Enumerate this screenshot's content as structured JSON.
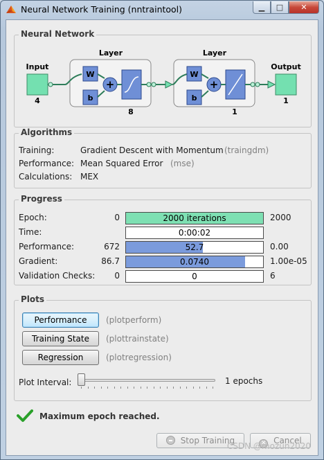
{
  "window": {
    "title": "Neural Network Training (nntraintool)"
  },
  "network": {
    "section_title": "Neural Network",
    "input_label": "Input",
    "input_size": "4",
    "hidden_layer_label": "Layer",
    "hidden_size": "8",
    "output_layer_label": "Layer",
    "output_layer_size": "1",
    "output_label": "Output",
    "output_size": "1",
    "weight_label": "W",
    "bias_label": "b",
    "sum_symbol": "+"
  },
  "algorithms": {
    "section_title": "Algorithms",
    "rows": [
      {
        "label": "Training:",
        "value": "Gradient Descent with Momentum",
        "func": "(traingdm)"
      },
      {
        "label": "Performance:",
        "value": "Mean Squared Error",
        "func": "(mse)"
      },
      {
        "label": "Calculations:",
        "value": "MEX",
        "func": ""
      }
    ]
  },
  "progress": {
    "section_title": "Progress",
    "rows": [
      {
        "label": "Epoch:",
        "start": "0",
        "bar_text": "2000 iterations",
        "end": "2000",
        "fill": 1.0,
        "fill_color": "#7ee0b3"
      },
      {
        "label": "Time:",
        "start": "",
        "bar_text": "0:00:02",
        "end": "",
        "fill": 0,
        "fill_color": "#ffffff"
      },
      {
        "label": "Performance:",
        "start": "672",
        "bar_text": "52.7",
        "end": "0.00",
        "fill": 0.56,
        "fill_color": "#7b9bdc"
      },
      {
        "label": "Gradient:",
        "start": "86.7",
        "bar_text": "0.0740",
        "end": "1.00e-05",
        "fill": 0.87,
        "fill_color": "#7b9bdc"
      },
      {
        "label": "Validation Checks:",
        "start": "0",
        "bar_text": "0",
        "end": "6",
        "fill": 0,
        "fill_color": "#ffffff"
      }
    ]
  },
  "plots": {
    "section_title": "Plots",
    "buttons": [
      {
        "label": "Performance",
        "func": "(plotperform)"
      },
      {
        "label": "Training State",
        "func": "(plottrainstate)"
      },
      {
        "label": "Regression",
        "func": "(plotregression)"
      }
    ],
    "interval_label": "Plot Interval:",
    "interval_value": "1 epochs",
    "interval_level": 0.0
  },
  "status": {
    "message": "Maximum epoch reached."
  },
  "footer": {
    "stop_label": "Stop Training",
    "cancel_label": "Cancel"
  },
  "watermark": "CSDN @mozun2020",
  "colors": {
    "node_green": "#74e0b0",
    "block_blue": "#6f8fd6",
    "check_green": "#2aa02a"
  }
}
